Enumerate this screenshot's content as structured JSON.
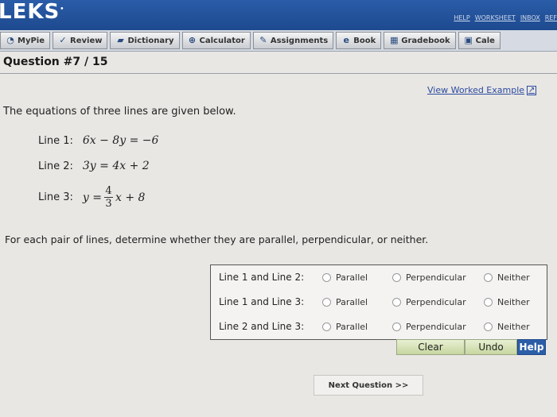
{
  "app": {
    "logo": "LEKS",
    "logo_mark": "•"
  },
  "top_links": [
    "HELP",
    "WORKSHEET",
    "INBOX",
    "REF"
  ],
  "tabs": [
    {
      "label": "MyPie",
      "icon": "pie-icon"
    },
    {
      "label": "Review",
      "icon": "check-icon"
    },
    {
      "label": "Dictionary",
      "icon": "book-icon"
    },
    {
      "label": "Calculator",
      "icon": "calculator-icon"
    },
    {
      "label": "Assignments",
      "icon": "assignment-icon"
    },
    {
      "label": "Book",
      "icon": "ebook-icon"
    },
    {
      "label": "Gradebook",
      "icon": "gradebook-icon"
    },
    {
      "label": "Cale",
      "icon": "calendar-icon"
    }
  ],
  "question": {
    "title": "Question #7 / 15"
  },
  "worked_example": "View Worked Example",
  "intro": "The equations of three lines are given below.",
  "lines": [
    {
      "label": "Line 1:",
      "equation": "6x − 8y = −6"
    },
    {
      "label": "Line 2:",
      "equation": "3y = 4x + 2"
    },
    {
      "label": "Line 3:",
      "prefix": "y =",
      "num": "4",
      "den": "3",
      "suffix": "x + 8"
    }
  ],
  "instruction": "For each pair of lines, determine whether they are parallel, perpendicular, or neither.",
  "pairs": [
    {
      "label": "Line 1 and Line 2:"
    },
    {
      "label": "Line 1 and Line 3:"
    },
    {
      "label": "Line 2 and Line 3:"
    }
  ],
  "options": [
    "Parallel",
    "Perpendicular",
    "Neither"
  ],
  "buttons": {
    "clear": "Clear",
    "undo": "Undo",
    "help": "Help"
  },
  "next_question": "Next Question >>"
}
